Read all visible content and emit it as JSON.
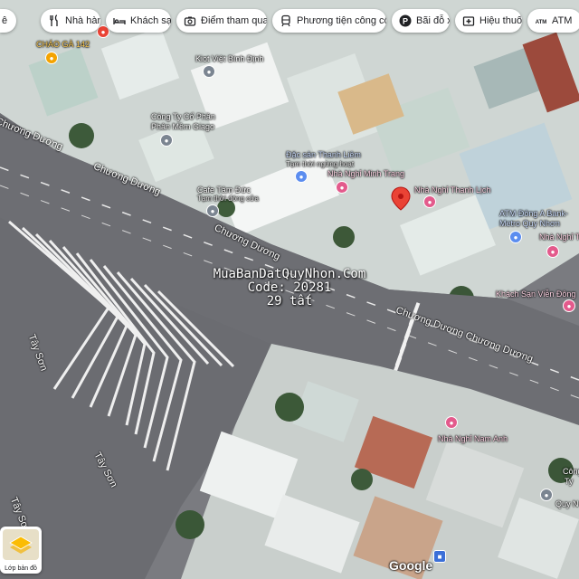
{
  "chips": [
    {
      "label": "ê",
      "icon": "chevron-icon"
    },
    {
      "label": "Nhà hàng",
      "icon": "restaurant-icon"
    },
    {
      "label": "Khách sạn",
      "icon": "hotel-icon"
    },
    {
      "label": "Điểm tham quan",
      "icon": "camera-icon"
    },
    {
      "label": "Phương tiện công cộ...",
      "icon": "transit-icon"
    },
    {
      "label": "Bãi đỗ xe",
      "icon": "parking-icon"
    },
    {
      "label": "Hiệu thuốc",
      "icon": "pharmacy-icon"
    },
    {
      "label": "ATM",
      "icon": "atm-icon"
    }
  ],
  "pois": {
    "chao_ga": "CHÁO GÀ 142",
    "kiot": "Kiot Việt Bình Định",
    "cong_ty": "Công Ty Cổ Phần",
    "cong_ty2": "Phân Mềm Giago",
    "dac_san": "Đặc sản Thanh Liêm",
    "dac_san_sub": "Tạm thời ngừng hoạt",
    "nha_nghi_minh_trang": "Nhà Nghỉ Minh Trang",
    "nha_nghi_thanh_lich": "Nhà Nghỉ Thanh Lịch",
    "cafe": "Cafe Tâm Đức",
    "cafe_sub": "Tạm thời đóng cửa",
    "atm1": "ATM Đông A Bank-",
    "atm2": "Metro Quy Nhơn",
    "nha_nghi_right": "Nhà Nghỉ T",
    "khach_san": "Khách Sạn Viễn Đông",
    "nha_nghi_nam_anh": "Nhà Nghỉ Nam Anh",
    "cong_bottom": "Công",
    "cong_bottom2": "Ty",
    "cong_bottom3": "Quy N"
  },
  "roads": {
    "chuong_duong_1": "Chương Dương",
    "chuong_duong_2": "Chương Dương",
    "chuong_duong_3": "Chương Dương",
    "chuong_duong_4": "Chương Dương Chương Dương",
    "tay_son_1": "Tây Sơn",
    "tay_son_2": "Tây Sơn",
    "tay_son_3": "Tây Sơ"
  },
  "watermark": {
    "line1": "MuaBanDatQuyNhon.Com",
    "line2": "Code: 20281",
    "line3": "29 tất"
  },
  "layer_button": {
    "label": "Lớp bản đồ"
  },
  "google_logo": "Google",
  "colors": {
    "pin_red": "#ea4335",
    "hotel_pink": "#e35a8c",
    "shop_blue": "#5b8def",
    "road_gray": "#6d6e73",
    "roof_white": "#e8ecec"
  }
}
